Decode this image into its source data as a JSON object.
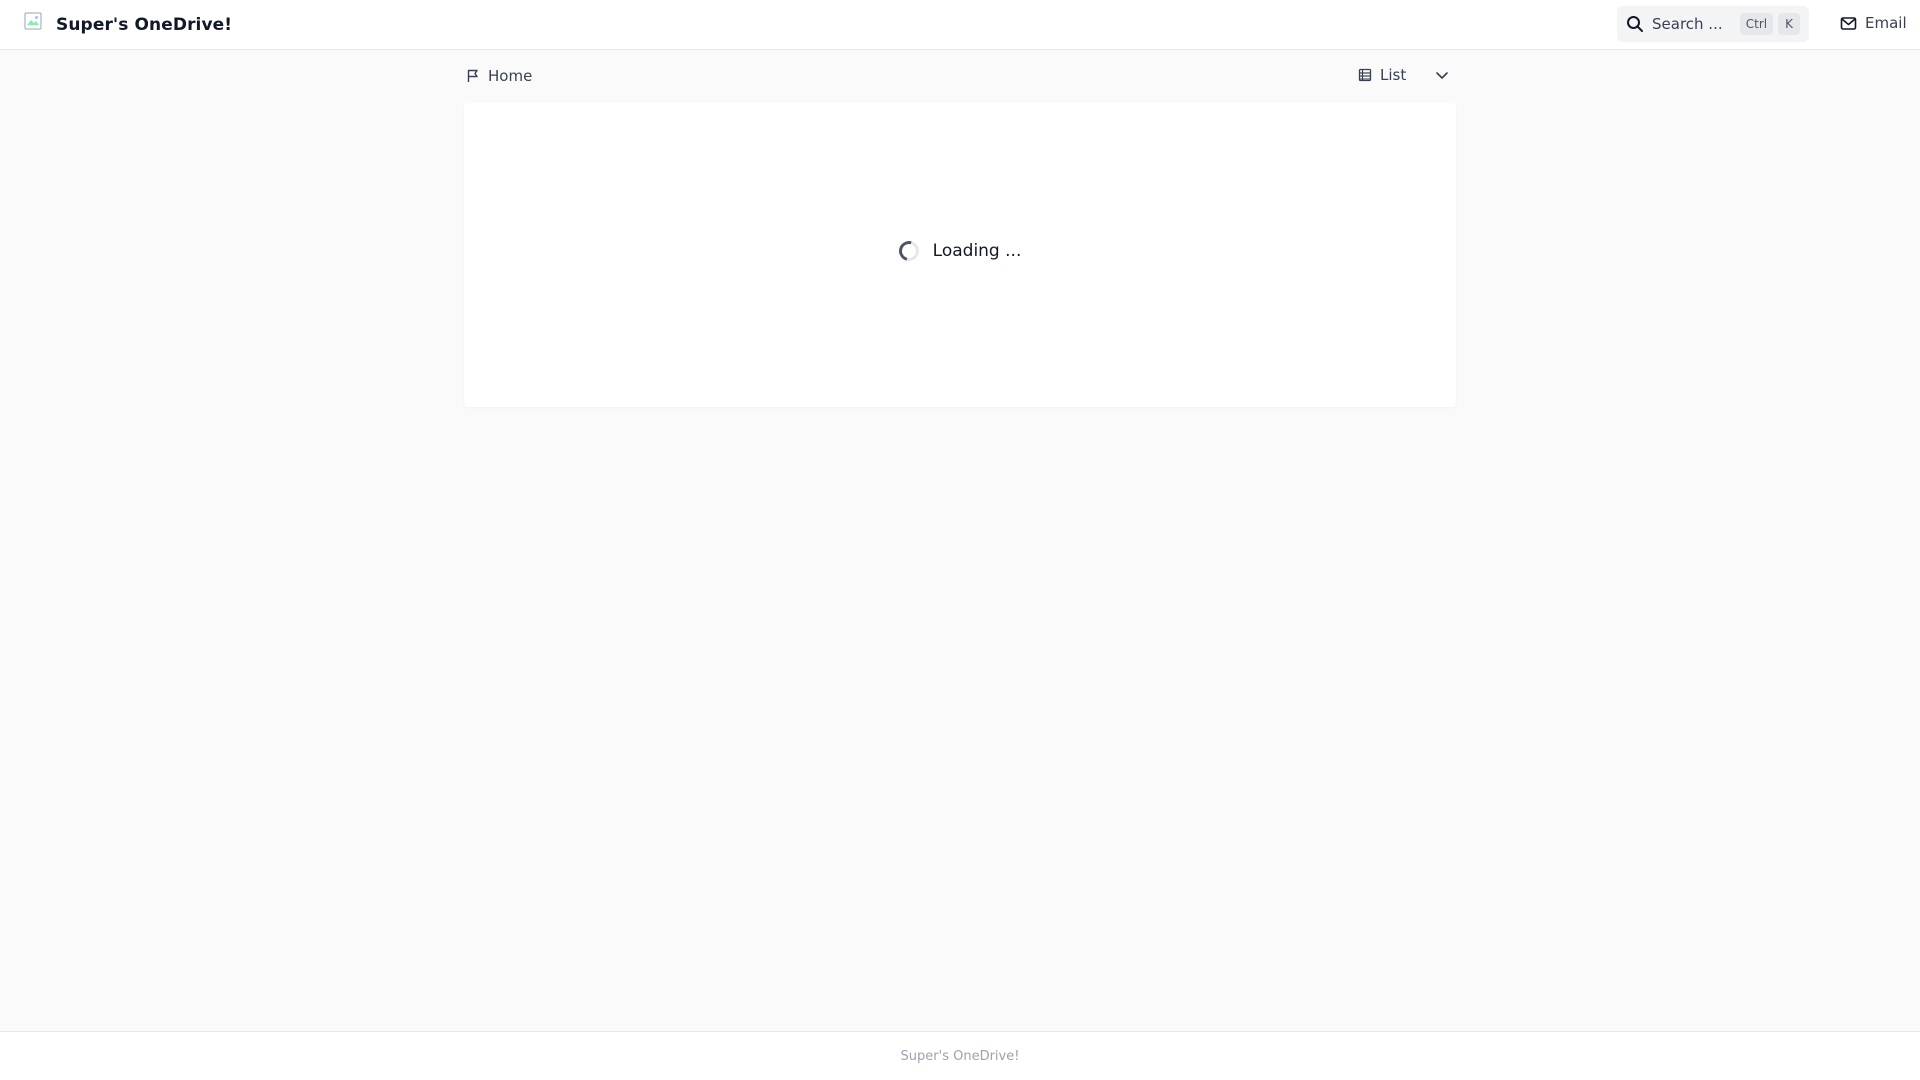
{
  "header": {
    "title": "Super's OneDrive!",
    "logo_icon": "broken-image-icon",
    "search": {
      "label": "Search ...",
      "shortcut_mod": "Ctrl",
      "shortcut_key": "K",
      "icon": "search-icon"
    },
    "email": {
      "label": "Email",
      "icon": "mail-icon"
    }
  },
  "toolbar": {
    "breadcrumb_home": "Home",
    "breadcrumb_icon": "flag-icon",
    "layout_label": "List",
    "layout_icon": "list-icon",
    "dropdown_icon": "chevron-down-icon"
  },
  "main": {
    "loading_text": "Loading ..."
  },
  "footer": {
    "text": "Super's OneDrive!"
  },
  "colors": {
    "background": "#fafafa",
    "surface": "#ffffff",
    "border": "#e5e7eb",
    "text": "#111827",
    "muted_text": "#9ca3af"
  }
}
